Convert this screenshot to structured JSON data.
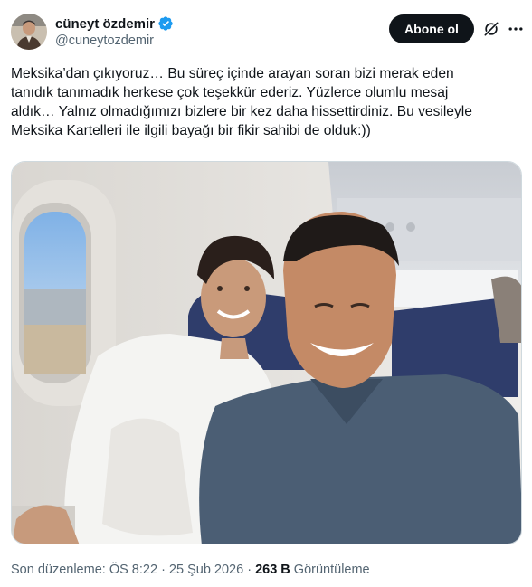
{
  "author": {
    "display_name": "cüneyt özdemir",
    "handle": "@cuneytozdemir",
    "verified": true
  },
  "actions": {
    "follow_label": "Abone ol",
    "grok_icon": "grok-icon",
    "more_icon": "more-icon"
  },
  "tweet": {
    "text": "Meksika’dan çıkıyoruz… Bu süreç içinde arayan soran bizi merak eden\ntanıdık tanımadık herkese çok teşekkür ederiz. Yüzlerce olumlu mesaj\naldık… Yalnız olmadığımızı bizlere bir kez daha hissettirdiniz. Bu vesileyle\nMeksika Kartelleri ile ilgili bayağı bir fikir sahibi de olduk:))"
  },
  "media": {
    "type": "photo",
    "subject": "airplane-selfie"
  },
  "meta": {
    "edited_label": "Son düzenleme:",
    "time": "ÖS 8:22",
    "date": "25 Şub 2026",
    "views_count": "263 B",
    "views_label": "Görüntüleme"
  },
  "colors": {
    "verified": "#1d9bf0",
    "text": "#0f1419",
    "secondary": "#536471",
    "button": "#0f1419"
  }
}
